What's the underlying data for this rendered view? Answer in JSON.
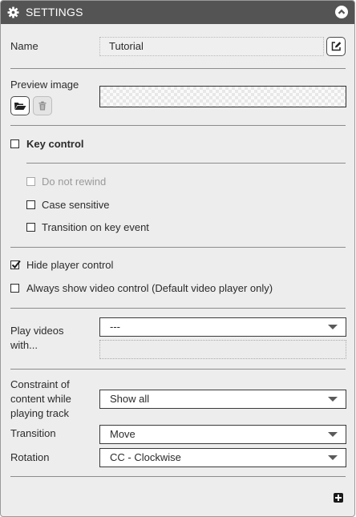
{
  "header": {
    "title": "SETTINGS",
    "icon": "gear-icon",
    "collapse_icon": "chevron-up-icon"
  },
  "name": {
    "label": "Name",
    "value": "Tutorial",
    "edit_icon": "edit-icon"
  },
  "preview": {
    "label": "Preview image",
    "open_icon": "folder-open-icon",
    "delete_icon": "trash-icon"
  },
  "key_control": {
    "label": "Key control",
    "checked": false,
    "options": [
      {
        "label": "Do not rewind",
        "checked": false,
        "disabled": true
      },
      {
        "label": "Case sensitive",
        "checked": false,
        "disabled": false
      },
      {
        "label": "Transition on key event",
        "checked": false,
        "disabled": false
      }
    ]
  },
  "player": {
    "hide_player_control": {
      "label": "Hide player control",
      "checked": true
    },
    "always_show_video_control": {
      "label": "Always show video control (Default video player only)",
      "checked": false
    }
  },
  "play_videos": {
    "label_line1": "Play videos",
    "label_line2": "with...",
    "value": "---"
  },
  "constraint": {
    "line1": "Constraint of",
    "line2": "content while",
    "line3": "playing track",
    "value": "Show all"
  },
  "transition": {
    "label": "Transition",
    "value": "Move"
  },
  "rotation": {
    "label": "Rotation",
    "value": "CC - Clockwise"
  },
  "footer": {
    "add_icon": "plus-square-icon"
  }
}
